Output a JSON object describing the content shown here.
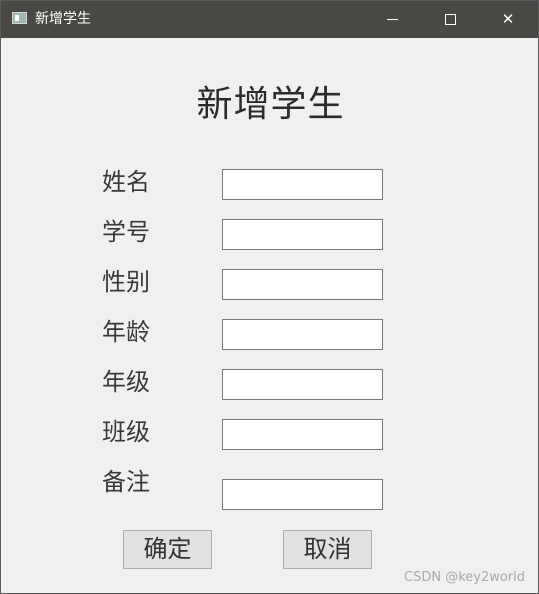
{
  "window": {
    "title": "新增学生",
    "icon": "app-window-icon",
    "controls": {
      "minimize": "minimize-icon",
      "maximize": "maximize-icon",
      "close": "close-icon",
      "close_glyph": "✕"
    }
  },
  "form": {
    "heading": "新增学生",
    "fields": [
      {
        "label": "姓名",
        "value": ""
      },
      {
        "label": "学号",
        "value": ""
      },
      {
        "label": "性别",
        "value": ""
      },
      {
        "label": "年龄",
        "value": ""
      },
      {
        "label": "年级",
        "value": ""
      },
      {
        "label": "班级",
        "value": ""
      },
      {
        "label": "备注",
        "value": ""
      }
    ],
    "ok_label": "确定",
    "cancel_label": "取消"
  },
  "watermark": "CSDN @key2world",
  "colors": {
    "titlebar": "#4a4844",
    "window_bg": "#f0f0f0",
    "button_bg": "#e1e1e1"
  }
}
